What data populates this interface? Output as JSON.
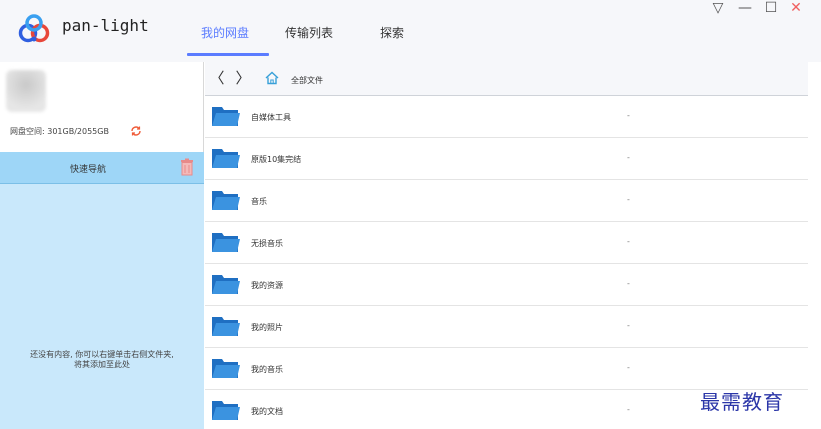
{
  "app": {
    "title": "pan-light",
    "logo_icon": "pan-light-logo"
  },
  "tabs": [
    {
      "label": "我的网盘",
      "active": true
    },
    {
      "label": "传输列表",
      "active": false
    },
    {
      "label": "探索",
      "active": false
    }
  ],
  "window_controls": {
    "dropdown": "▽",
    "minimize": "—",
    "maximize": "☐",
    "close": "✕"
  },
  "sidebar": {
    "quota_text": "网盘空间: 301GB/2055GB",
    "quick_nav_title": "快速导航",
    "empty_hint_line1": "还没有内容, 你可以右键单击右侧文件夹,",
    "empty_hint_line2": "将其添加至此处"
  },
  "toolbar": {
    "back": "〈",
    "forward": "〉",
    "breadcrumb": "全部文件"
  },
  "files": [
    {
      "name": "自媒体工具",
      "size": "-"
    },
    {
      "name": "原版10集完结",
      "size": "-"
    },
    {
      "name": "音乐",
      "size": "-"
    },
    {
      "name": "无损音乐",
      "size": "-"
    },
    {
      "name": "我的资源",
      "size": "-"
    },
    {
      "name": "我的照片",
      "size": "-"
    },
    {
      "name": "我的音乐",
      "size": "-"
    },
    {
      "name": "我的文档",
      "size": "-"
    }
  ],
  "watermark": "最需教育",
  "colors": {
    "accent": "#5b7cff",
    "nav_header": "#9ed6f7",
    "nav_body": "#c9e8fb",
    "folder": "#2f86d6",
    "refresh": "#ef5b38"
  }
}
